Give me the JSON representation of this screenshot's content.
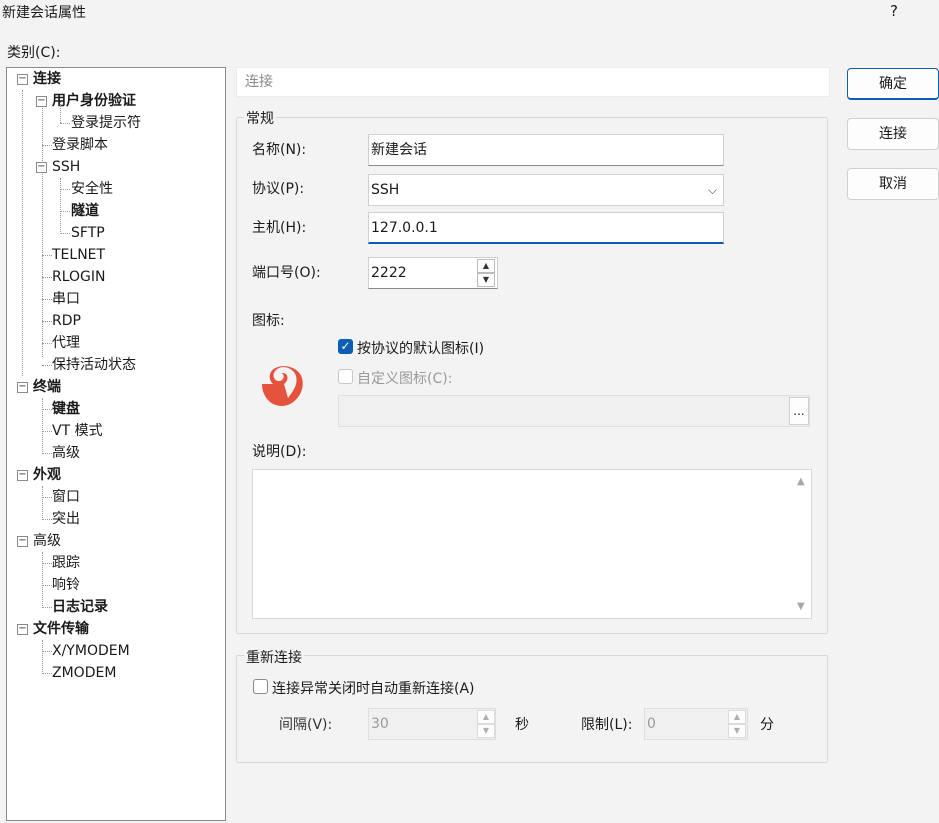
{
  "window": {
    "title": "新建会话属性",
    "help": "?"
  },
  "category_label": "类别(C):",
  "tree": {
    "items": [
      {
        "label": "连接",
        "bold": true,
        "expander": "minus"
      },
      {
        "label": "用户身份验证",
        "bold": true,
        "expander": "minus"
      },
      {
        "label": "登录提示符",
        "bold": false
      },
      {
        "label": "登录脚本",
        "bold": false
      },
      {
        "label": "SSH",
        "bold": false,
        "expander": "minus"
      },
      {
        "label": "安全性",
        "bold": false
      },
      {
        "label": "隧道",
        "bold": true
      },
      {
        "label": "SFTP",
        "bold": false
      },
      {
        "label": "TELNET",
        "bold": false
      },
      {
        "label": "RLOGIN",
        "bold": false
      },
      {
        "label": "串口",
        "bold": false
      },
      {
        "label": "RDP",
        "bold": false
      },
      {
        "label": "代理",
        "bold": false
      },
      {
        "label": "保持活动状态",
        "bold": false
      },
      {
        "label": "终端",
        "bold": true,
        "expander": "minus"
      },
      {
        "label": "键盘",
        "bold": true
      },
      {
        "label": "VT 模式",
        "bold": false
      },
      {
        "label": "高级",
        "bold": false
      },
      {
        "label": "外观",
        "bold": true,
        "expander": "minus"
      },
      {
        "label": "窗口",
        "bold": false
      },
      {
        "label": "突出",
        "bold": false
      },
      {
        "label": "高级",
        "bold": false,
        "expander": "minus"
      },
      {
        "label": "跟踪",
        "bold": false
      },
      {
        "label": "响铃",
        "bold": false
      },
      {
        "label": "日志记录",
        "bold": true
      },
      {
        "label": "文件传输",
        "bold": true,
        "expander": "minus"
      },
      {
        "label": "X/YMODEM",
        "bold": false
      },
      {
        "label": "ZMODEM",
        "bold": false
      }
    ]
  },
  "panel_header": "连接",
  "general": {
    "title": "常规",
    "name_label": "名称(N):",
    "name_value": "新建会话",
    "protocol_label": "协议(P):",
    "protocol_value": "SSH",
    "host_label": "主机(H):",
    "host_value": "127.0.0.1",
    "port_label": "端口号(O):",
    "port_value": "2222",
    "icon_label": "图标:",
    "default_icon_label": "按协议的默认图标(I)",
    "default_icon_checked": true,
    "custom_icon_label": "自定义图标(C):",
    "custom_icon_checked": false,
    "browse_label": "...",
    "description_label": "说明(D):"
  },
  "reconnect": {
    "title": "重新连接",
    "auto_label": "连接异常关闭时自动重新连接(A)",
    "auto_checked": false,
    "interval_label": "间隔(V):",
    "interval_value": "30",
    "interval_unit": "秒",
    "limit_label": "限制(L):",
    "limit_value": "0",
    "limit_unit": "分"
  },
  "buttons": {
    "ok": "确定",
    "connect": "连接",
    "cancel": "取消"
  },
  "colors": {
    "accent": "#0a5fb4",
    "icon": "#e5533c"
  }
}
